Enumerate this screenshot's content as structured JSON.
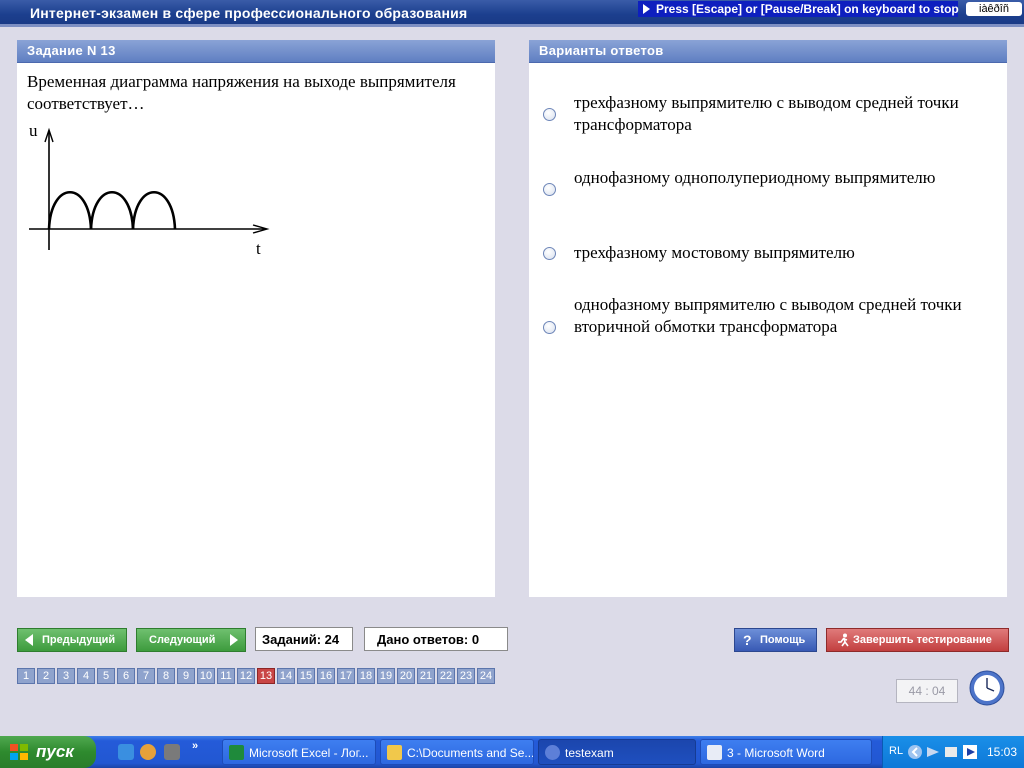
{
  "window": {
    "title": "Интернет-экзамен в сфере профессионального образования",
    "escape_hint": "Press [Escape] or [Pause/Break] on keyboard to stop",
    "lang_indicator": "iàêðîñ"
  },
  "task_panel": {
    "header": "Задание N 13",
    "question": "Временная диаграмма напряжения на выходе выпрямителя соответствует…",
    "diagram": {
      "y_axis_label": "u",
      "x_axis_label": "t"
    }
  },
  "answers_panel": {
    "header": "Варианты ответов",
    "options": [
      "трехфазному выпрямителю с выводом средней точки трансформатора",
      "однофазному однополупериодному выпрямителю",
      "трехфазному мостовому выпрямителю",
      "однофазному выпрямителю с выводом средней точки вторичной обмотки трансформатора"
    ]
  },
  "controls": {
    "prev_label": "Предыдущий",
    "next_label": "Следующий",
    "tasks_count": "Заданий: 24",
    "answers_given": "Дано ответов: 0",
    "help_label": "Помощь",
    "finish_label": "Завершить тестирование",
    "timer": "44 : 04"
  },
  "task_numbers": [
    "1",
    "2",
    "3",
    "4",
    "5",
    "6",
    "7",
    "8",
    "9",
    "10",
    "11",
    "12",
    "13",
    "14",
    "15",
    "16",
    "17",
    "18",
    "19",
    "20",
    "21",
    "22",
    "23",
    "24"
  ],
  "current_task": 13,
  "taskbar": {
    "start_label": "пуск",
    "items": [
      "Microsoft Excel - Лог...",
      "C:\\Documents and Se...",
      "testexam",
      "3 - Microsoft Word"
    ],
    "lang": "RL",
    "time": "15:03"
  }
}
